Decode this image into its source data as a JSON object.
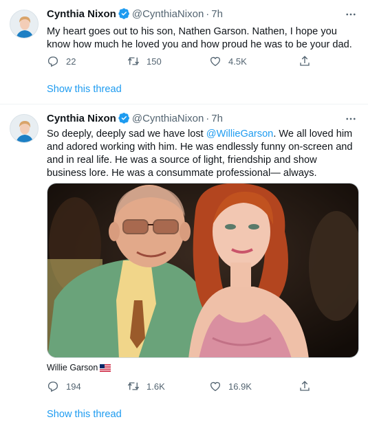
{
  "tweets": [
    {
      "author": "Cynthia Nixon",
      "handle": "@CynthiaNixon",
      "separator": "·",
      "time": "7h",
      "text": "My heart goes out to his son, Nathen Garson. Nathen, I hope you know how much he loved you and how proud he was to be your dad.",
      "replies": "22",
      "retweets": "150",
      "likes": "4.5K",
      "show_thread": "Show this thread"
    },
    {
      "author": "Cynthia Nixon",
      "handle": "@CynthiaNixon",
      "separator": "·",
      "time": "7h",
      "text_before": "So deeply, deeply sad we have lost ",
      "mention": "@WillieGarson",
      "text_after": ". We all loved him and adored working with him. He was endlessly funny on-screen and and in real life. He was a source of light, friendship and show business lore. He was a consummate professional— always.",
      "photo_tag": "Willie Garson",
      "replies": "194",
      "retweets": "1.6K",
      "likes": "16.9K",
      "show_thread": "Show this thread"
    }
  ],
  "icons": {
    "verified": "verified-badge-icon",
    "more": "more-options-icon",
    "reply": "reply-icon",
    "retweet": "retweet-icon",
    "like": "like-icon",
    "share": "share-icon",
    "flag": "us-flag-icon"
  },
  "colors": {
    "link": "#1d9bf0",
    "secondary_text": "#536471",
    "divider": "#eff3f4"
  }
}
